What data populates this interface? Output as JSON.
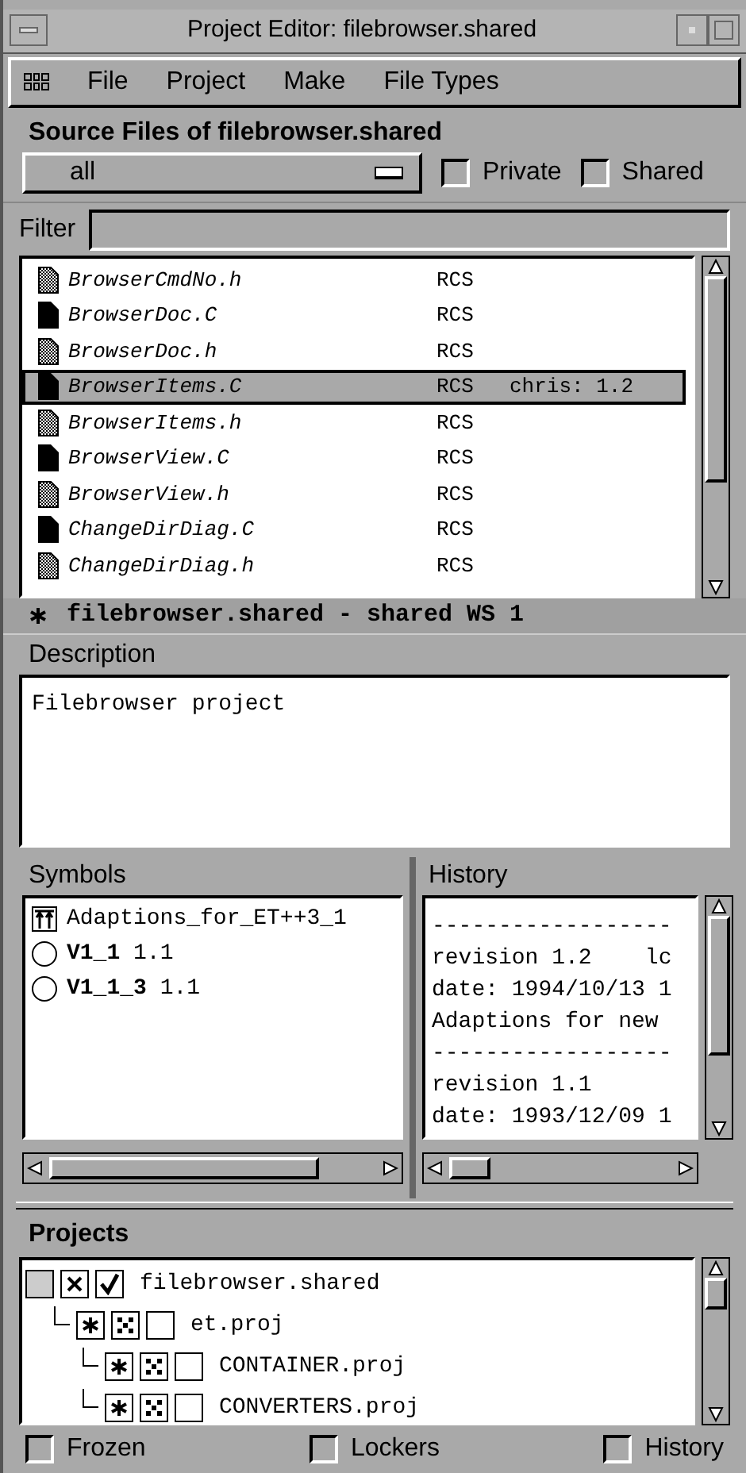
{
  "window": {
    "title": "Project Editor: filebrowser.shared"
  },
  "menu": [
    "File",
    "Project",
    "Make",
    "File Types"
  ],
  "source_files": {
    "title": "Source Files of filebrowser.shared",
    "filter_select": "all",
    "options": [
      {
        "label": "Private",
        "checked": false
      },
      {
        "label": "Shared",
        "checked": false
      }
    ],
    "filter_label": "Filter",
    "files": [
      {
        "name": "BrowserCmdNo.h",
        "kind": "header",
        "vcs": "RCS",
        "selected": false
      },
      {
        "name": "BrowserDoc.C",
        "kind": "source",
        "vcs": "RCS",
        "selected": false
      },
      {
        "name": "BrowserDoc.h",
        "kind": "header",
        "vcs": "RCS",
        "selected": false
      },
      {
        "name": "BrowserItems.C",
        "kind": "source",
        "vcs": "RCS",
        "locker": "chris: 1.2",
        "selected": true
      },
      {
        "name": "BrowserItems.h",
        "kind": "header",
        "vcs": "RCS",
        "selected": false
      },
      {
        "name": "BrowserView.C",
        "kind": "source",
        "vcs": "RCS",
        "selected": false
      },
      {
        "name": "BrowserView.h",
        "kind": "header",
        "vcs": "RCS",
        "selected": false
      },
      {
        "name": "ChangeDirDiag.C",
        "kind": "source",
        "vcs": "RCS",
        "selected": false
      },
      {
        "name": "ChangeDirDiag.h",
        "kind": "header",
        "vcs": "RCS",
        "selected": false
      }
    ]
  },
  "status": "filebrowser.shared - shared WS 1",
  "description": {
    "label": "Description",
    "text": "Filebrowser project"
  },
  "symbols": {
    "label": "Symbols",
    "items": [
      {
        "kind": "branch",
        "name": "Adaptions_for_ET++3_1"
      },
      {
        "kind": "version",
        "name": "V1_1",
        "revision": "1.1"
      },
      {
        "kind": "version",
        "name": "V1_1_3",
        "revision": "1.1"
      }
    ]
  },
  "history": {
    "label": "History",
    "lines": [
      "------------------",
      "revision 1.2    lc",
      "date: 1994/10/13 1",
      "Adaptions for new",
      "------------------",
      "revision 1.1",
      "date: 1993/12/09 1"
    ]
  },
  "projects": {
    "label": "Projects",
    "tree": [
      {
        "name": "filebrowser.shared",
        "kind": "root",
        "checked": true,
        "children": [
          {
            "name": "et.proj",
            "kind": "sub",
            "checked": false,
            "children": [
              {
                "name": "CONTAINER.proj",
                "kind": "sub",
                "checked": false
              },
              {
                "name": "CONVERTERS.proj",
                "kind": "sub",
                "checked": false
              }
            ]
          }
        ]
      }
    ]
  },
  "bottom_options": [
    {
      "label": "Frozen",
      "checked": false
    },
    {
      "label": "Lockers",
      "checked": false
    },
    {
      "label": "History",
      "checked": false
    }
  ]
}
